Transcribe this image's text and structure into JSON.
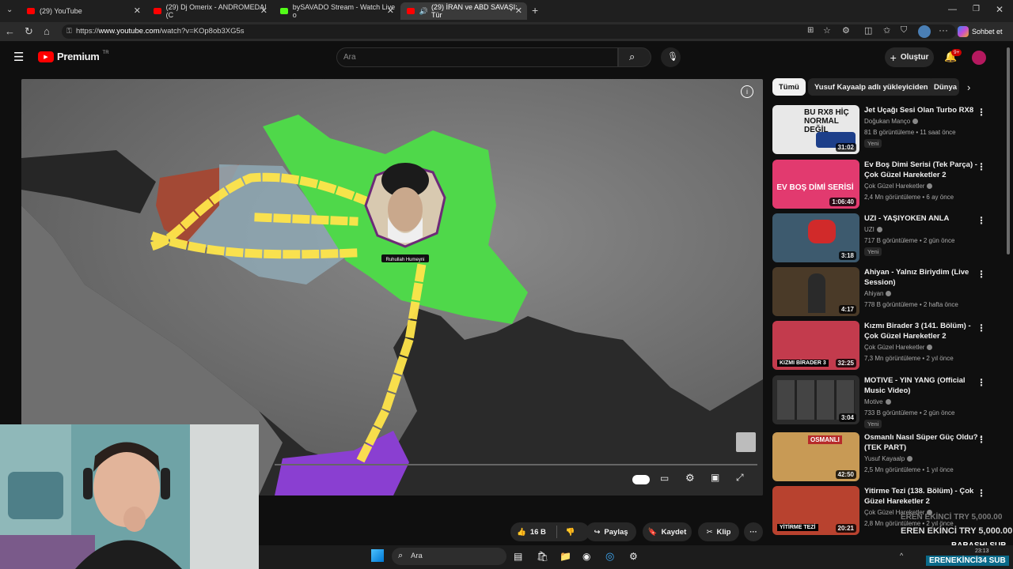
{
  "browser": {
    "tabs": [
      {
        "label": "(29) YouTube",
        "icon": "youtube-icon"
      },
      {
        "label": "(29) Dj Omerix - ANDROMEDA! (C",
        "icon": "youtube-icon"
      },
      {
        "label": "bySAVADO Stream - Watch Live o",
        "icon": "kick-icon"
      },
      {
        "label": "(29) İRAN ve ABD SAVAŞI: Tür",
        "icon": "youtube-icon"
      }
    ],
    "url_prefix": "https://",
    "url_host": "www.youtube.com",
    "url_path": "/watch?v=KOp8ob3XG5s",
    "chat_button": "Sohbet et"
  },
  "youtube": {
    "logo": "Premium",
    "logo_region": "TR",
    "search_placeholder": "Ara",
    "create_label": "Oluştur",
    "notification_count": "9+"
  },
  "video": {
    "portrait_caption": "Ruhullah Humeyni"
  },
  "chips": [
    "Tümü",
    "Yusuf Kayaalp adlı yükleyiciden",
    "Dünya"
  ],
  "recommendations": [
    {
      "title": "Jet Uçağı Sesi Olan Turbo RX8",
      "channel": "Doğukan Manço",
      "meta": "81 B görüntüleme • 11 saat önce",
      "badge": "Yeni",
      "duration": "31:02",
      "thumb_text": "BU RX8 HİÇ NORMAL DEĞİL",
      "thumb_color": "#e8e8e8"
    },
    {
      "title": "Ev Boş Dimi Serisi (Tek Parça) - Çok Güzel Hareketler 2",
      "channel": "Çok Güzel Hareketler",
      "meta": "2,4 Mn görüntüleme • 6 ay önce",
      "badge": "",
      "duration": "1:06:40",
      "thumb_text": "EV BOŞ DİMİ SERİSİ",
      "thumb_color": "#e23a6f"
    },
    {
      "title": "UZI - YAŞIYOKEN ANLA",
      "channel": "UZI",
      "meta": "717 B görüntüleme • 2 gün önce",
      "badge": "Yeni",
      "duration": "3:18",
      "thumb_text": "",
      "thumb_color": "#3d5a6e"
    },
    {
      "title": "Ahiyan - Yalnız Biriydim (Live Session)",
      "channel": "Ahiyan",
      "meta": "778 B görüntüleme • 2 hafta önce",
      "badge": "",
      "duration": "4:17",
      "thumb_text": "",
      "thumb_color": "#4a3a28"
    },
    {
      "title": "Kızmı Birader 3 (141. Bölüm) - Çok Güzel Hareketler 2",
      "channel": "Çok Güzel Hareketler",
      "meta": "7,3 Mn görüntüleme • 2 yıl önce",
      "badge": "",
      "duration": "32:25",
      "thumb_text": "KIZMI BİRADER 3",
      "thumb_color": "#c33b4d"
    },
    {
      "title": "MOTIVE - YIN YANG (Official Music Video)",
      "channel": "Motive",
      "meta": "733 B görüntüleme • 2 gün önce",
      "badge": "Yeni",
      "duration": "3:04",
      "thumb_text": "",
      "thumb_color": "#2c2c2c"
    },
    {
      "title": "Osmanlı Nasıl Süper Güç Oldu? - (TEK PART)",
      "channel": "Yusuf Kayaalp",
      "meta": "2,5 Mn görüntüleme • 1 yıl önce",
      "badge": "",
      "duration": "42:50",
      "thumb_text": "OSMANLI",
      "thumb_color": "#c89a55"
    },
    {
      "title": "Yitirme Tezi (138. Bölüm) - Çok Güzel Hareketler 2",
      "channel": "Çok Güzel Hareketler",
      "meta": "2,8 Mn görüntüleme • 2 yıl önce",
      "badge": "",
      "duration": "20:21",
      "thumb_text": "YİTİRME TEZİ",
      "thumb_color": "#b8422f"
    }
  ],
  "actions": {
    "likes": "16 B",
    "share": "Paylaş",
    "save": "Kaydet",
    "clip": "Klip"
  },
  "stream_overlay": {
    "donation1": "EREN EKİNCİ  TRY 5,000.00",
    "donation2": "EREN EKİNCİ  TRY 5,000.00",
    "sub_label": "BABASHI  SUB",
    "sub_label2": "ERENEKİNCİ34  SUB"
  },
  "taskbar": {
    "search_placeholder": "Ara",
    "time": "23:13"
  },
  "colors": {
    "youtube_red": "#ff0000",
    "iran_green": "#4fd84a",
    "route_yellow": "#ffe54a",
    "yemen_purple": "#8a3fd1",
    "syria_red": "#a8452f",
    "iraq_blue": "#8fa9b5"
  }
}
